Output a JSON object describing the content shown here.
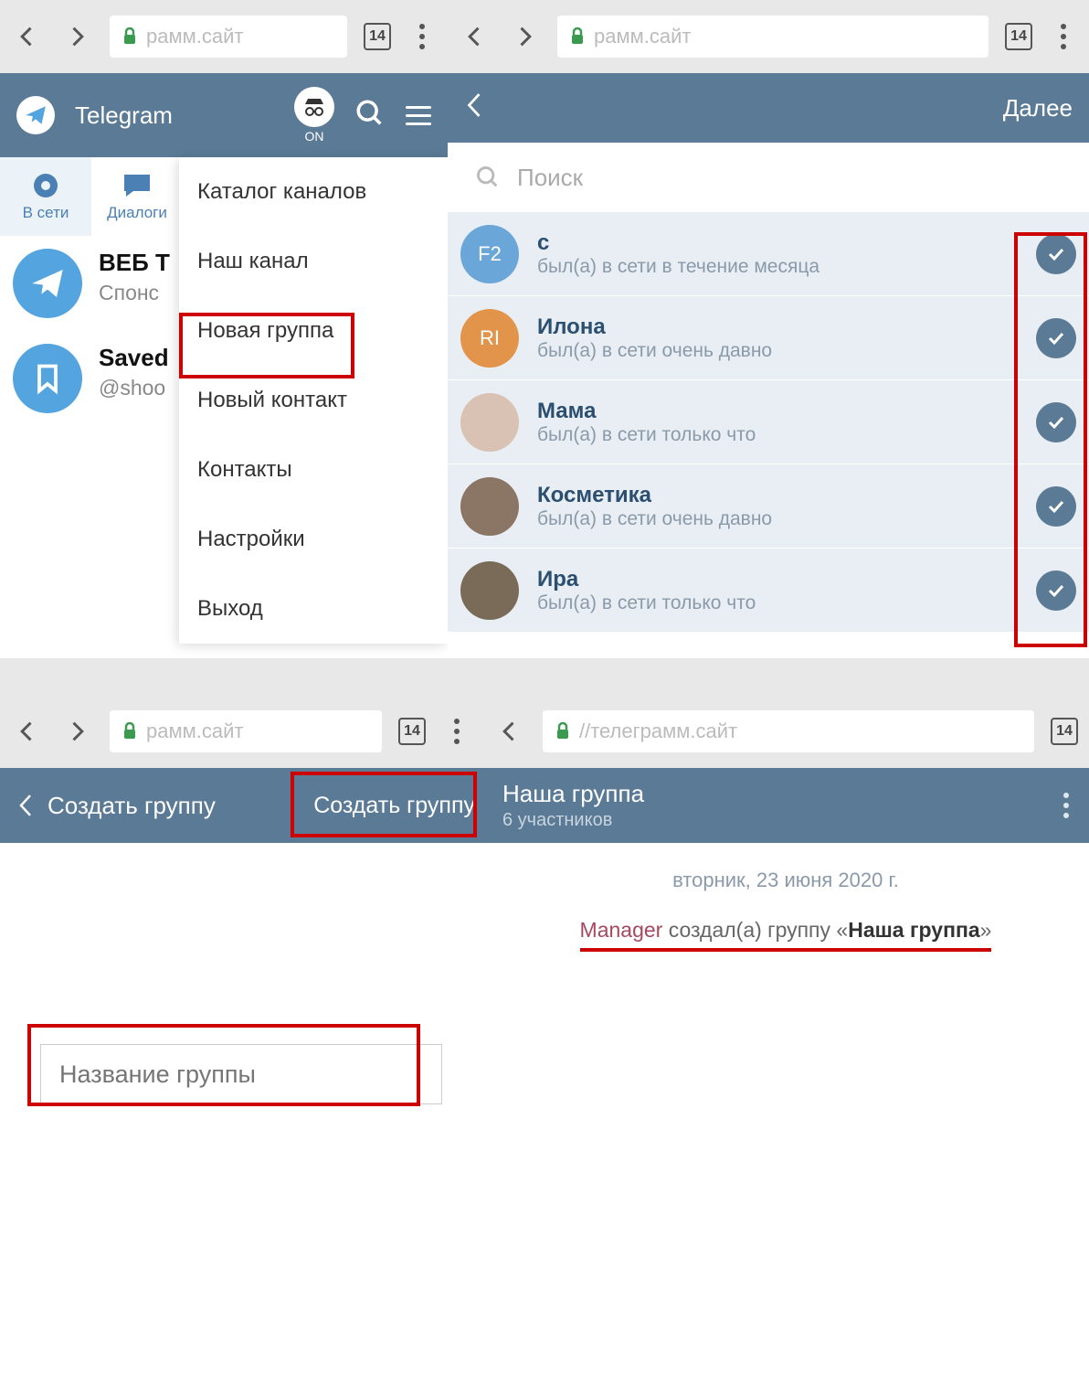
{
  "browser": {
    "url_stub1": "рамм.сайт",
    "url_stub1b": "рамм.сайт",
    "url_stub2": "//телеграмм.сайт",
    "tab_count": "14"
  },
  "panel1": {
    "app_title": "Telegram",
    "incognito_label": "ON",
    "tabs": {
      "online": "В сети",
      "dialogs": "Диалоги"
    },
    "chats": [
      {
        "name": "ВЕБ Т",
        "sub": "Спонс"
      },
      {
        "name": "Saved",
        "sub": "@shoo"
      }
    ],
    "dropdown": [
      "Каталог каналов",
      "Наш канал",
      "Новая группа",
      "Новый контакт",
      "Контакты",
      "Настройки",
      "Выход"
    ]
  },
  "panel2": {
    "next_label": "Далее",
    "search_placeholder": "Поиск",
    "contacts": [
      {
        "avatar_text": "F2",
        "name": "с",
        "status": "был(а) в сети в течение месяца",
        "avatar_color": "#6aa6d8"
      },
      {
        "avatar_text": "RI",
        "name": "Илона",
        "status": "был(а) в сети очень давно",
        "avatar_color": "#e2954a"
      },
      {
        "avatar_text": "",
        "name": "Мама",
        "status": "был(а) в сети только что",
        "avatar_color": "#d9c2b3"
      },
      {
        "avatar_text": "",
        "name": "Косметика",
        "status": "был(а) в сети очень давно",
        "avatar_color": "#8b7665"
      },
      {
        "avatar_text": "",
        "name": "Ира",
        "status": "был(а) в сети только что",
        "avatar_color": "#7a6a58"
      }
    ]
  },
  "panel3": {
    "back_label": "Создать группу",
    "create_label": "Создать группу",
    "input_placeholder": "Название группы"
  },
  "panel4": {
    "group_title": "Наша группа",
    "members_label": "6 участников",
    "date_label": "вторник, 23 июня 2020 г.",
    "manager_label": "Manager",
    "created_text": " создал(а) группу «",
    "group_name": "Наша группа",
    "closing": "»"
  },
  "colors": {
    "header_bg": "#5a7a96",
    "accent": "#54a4e0",
    "red_highlight": "#c00"
  }
}
